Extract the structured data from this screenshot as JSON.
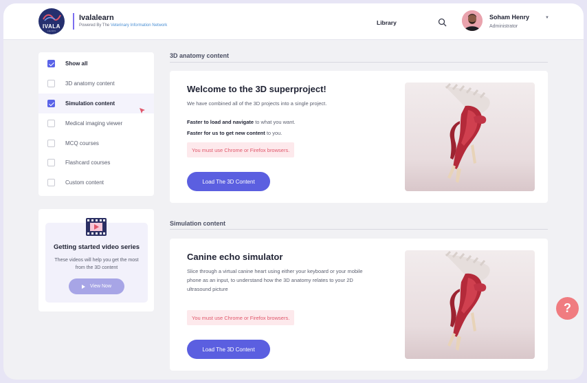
{
  "header": {
    "logo_text": "IVALA",
    "logo_sub": "LEARN",
    "brand_name": "Ivalalearn",
    "brand_sub_prefix": "Powered By The",
    "brand_sub_link": "Veterinary Information Network",
    "nav_library": "Library",
    "user_name": "Soham Henry",
    "user_role": "Administrator"
  },
  "filters": {
    "items": [
      {
        "label": "Show all",
        "checked": true
      },
      {
        "label": "3D anatomy content",
        "checked": false
      },
      {
        "label": "Simulation content",
        "checked": true
      },
      {
        "label": "Medical imaging viewer",
        "checked": false
      },
      {
        "label": "MCQ courses",
        "checked": false
      },
      {
        "label": "Flashcard courses",
        "checked": false
      },
      {
        "label": "Custom content",
        "checked": false
      }
    ]
  },
  "video_card": {
    "title": "Getting started video series",
    "description": "These videos will help you get the most from the 3D content",
    "button_label": "View Now"
  },
  "sections": [
    {
      "title": "3D anatomy content",
      "card": {
        "title": "Welcome to the 3D superproject!",
        "description": "We have combined all of the 3D projects into a single project.",
        "feature1_bold": "Faster to load and navigate",
        "feature1_rest": " to what you want.",
        "feature2_bold": "Faster for us to get new content",
        "feature2_rest": " to you.",
        "warning": "You must use Chrome or Firefox browsers.",
        "button_label": "Load The 3D Content"
      }
    },
    {
      "title": "Simulation content",
      "card": {
        "title": "Canine echo simulator",
        "description": "Slice through a virtual canine heart using either your keyboard or your mobile phone as an input, to understand how the 3D anatomy relates to your 2D ultrasound picture",
        "warning": "You must use Chrome or Firefox browsers.",
        "button_label": "Load The 3D Content"
      }
    }
  ],
  "help": {
    "label": "?"
  },
  "colors": {
    "accent": "#5b5fe0",
    "checkbox": "#5a63e8",
    "warning_bg": "#fde9ec",
    "warning_text": "#e0566a",
    "help": "#f07c80",
    "logo": "#25306f"
  }
}
